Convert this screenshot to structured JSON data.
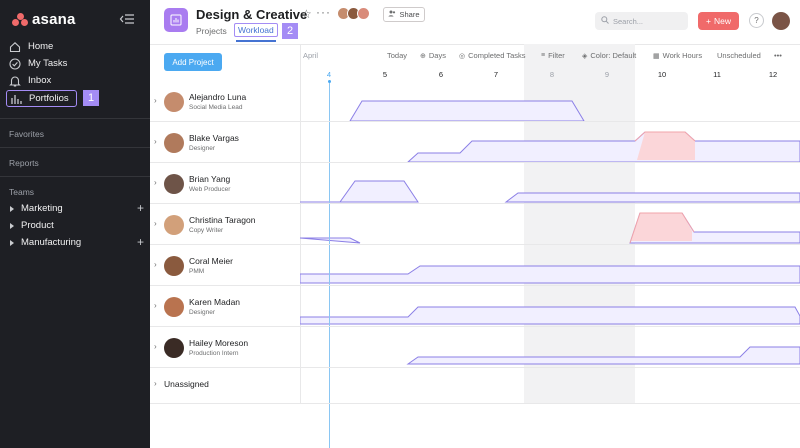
{
  "sidebar": {
    "logo_text": "asana",
    "nav": [
      {
        "label": "Home",
        "icon": "home-icon"
      },
      {
        "label": "My Tasks",
        "icon": "check-circle-icon"
      },
      {
        "label": "Inbox",
        "icon": "bell-icon"
      },
      {
        "label": "Portfolios",
        "icon": "bar-chart-icon"
      }
    ],
    "favorites_label": "Favorites",
    "reports_label": "Reports",
    "teams_label": "Teams",
    "teams": [
      "Marketing",
      "Product",
      "Manufacturing"
    ],
    "callout_1": "1"
  },
  "header": {
    "title": "Design & Creative",
    "tabs": [
      "Projects",
      "Workload"
    ],
    "share_label": "Share",
    "search_placeholder": "Search...",
    "new_label": "New",
    "help_label": "?",
    "callout_2": "2"
  },
  "toolbar": {
    "add_project": "Add Project",
    "month": "April",
    "today": "Today",
    "days": "Days",
    "completed_tasks": "Completed Tasks",
    "filter": "Filter",
    "color": "Color: Default",
    "work_hours": "Work Hours",
    "unscheduled": "Unscheduled",
    "more": "•••"
  },
  "days": [
    "4",
    "5",
    "6",
    "7",
    "8",
    "9",
    "10",
    "11",
    "12"
  ],
  "rows": [
    {
      "name": "Alejandro Luna",
      "role": "Social Media Lead",
      "avatar_color": "#c58c6d"
    },
    {
      "name": "Blake Vargas",
      "role": "Designer",
      "avatar_color": "#b07a5c"
    },
    {
      "name": "Brian Yang",
      "role": "Web Producer",
      "avatar_color": "#6e5448"
    },
    {
      "name": "Christina Taragon",
      "role": "Copy Writer",
      "avatar_color": "#d2a07a"
    },
    {
      "name": "Coral Meier",
      "role": "PMM",
      "avatar_color": "#8a5a3e"
    },
    {
      "name": "Karen Madan",
      "role": "Designer",
      "avatar_color": "#b9734f"
    },
    {
      "name": "Hailey Moreson",
      "role": "Production Intern",
      "avatar_color": "#3a2b25"
    }
  ],
  "unassigned": "Unassigned",
  "colors": {
    "accent": "#a48cf5",
    "workload_line": "#8b7fe6",
    "over_capacity": "#fbd6d9",
    "today": "#4ba9f1",
    "new_button": "#f06a6a"
  }
}
